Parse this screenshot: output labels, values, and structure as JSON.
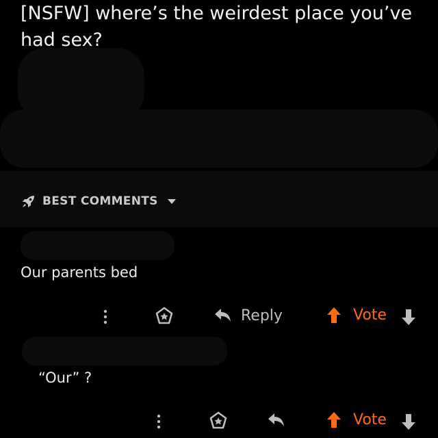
{
  "post": {
    "title": "[NSFW] where’s the weirdest place you’ve had sex?"
  },
  "sort": {
    "label": "BEST COMMENTS"
  },
  "comments": [
    {
      "text": "Our parents bed",
      "reply_label": "Reply",
      "vote_label": "Vote"
    },
    {
      "text": "“Our” ?",
      "vote_label": "Vote"
    }
  ],
  "colors": {
    "background": "#000000",
    "vote_orange": "#ff6a13",
    "muted": "#bdbdbd"
  },
  "icons": [
    "rocket-icon",
    "chevron-down-icon",
    "more-vertical-icon",
    "award-icon",
    "reply-arrow-icon",
    "upvote-icon",
    "downvote-icon"
  ]
}
